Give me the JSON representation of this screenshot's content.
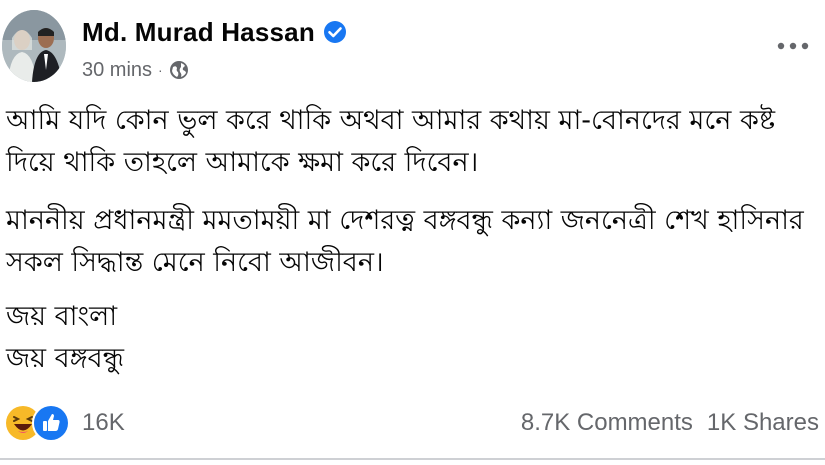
{
  "post": {
    "author": "Md. Murad Hassan",
    "verified": true,
    "timestamp": "30 mins",
    "separator": "·",
    "audience_icon": "globe-icon",
    "more_icon": "more-options-icon",
    "paragraphs": [
      "আমি যদি কোন ভুল করে থাকি অথবা আমার কথায় মা-বোনদের মনে কষ্ট দিয়ে থাকি তাহলে আমাকে ক্ষমা করে দিবেন।",
      "মাননীয় প্রধানমন্ত্রী মমতাময়ী মা দেশরত্ন বঙ্গবন্ধু কন্যা জননেত্রী শেখ হাসিনার সকল সিদ্ধান্ত মেনে নিবো আজীবন।"
    ],
    "closing_lines": [
      "জয় বাংলা",
      "জয় বঙ্গবন্ধু"
    ]
  },
  "footer": {
    "reactions": [
      "haha-icon",
      "like-icon"
    ],
    "reaction_count": "16K",
    "comments": "8.7K Comments",
    "shares": "1K Shares"
  },
  "colors": {
    "verified_blue": "#1877f2",
    "secondary_text": "#65676b",
    "haha_yellow": "#f7b928",
    "divider": "#ced0d4"
  }
}
